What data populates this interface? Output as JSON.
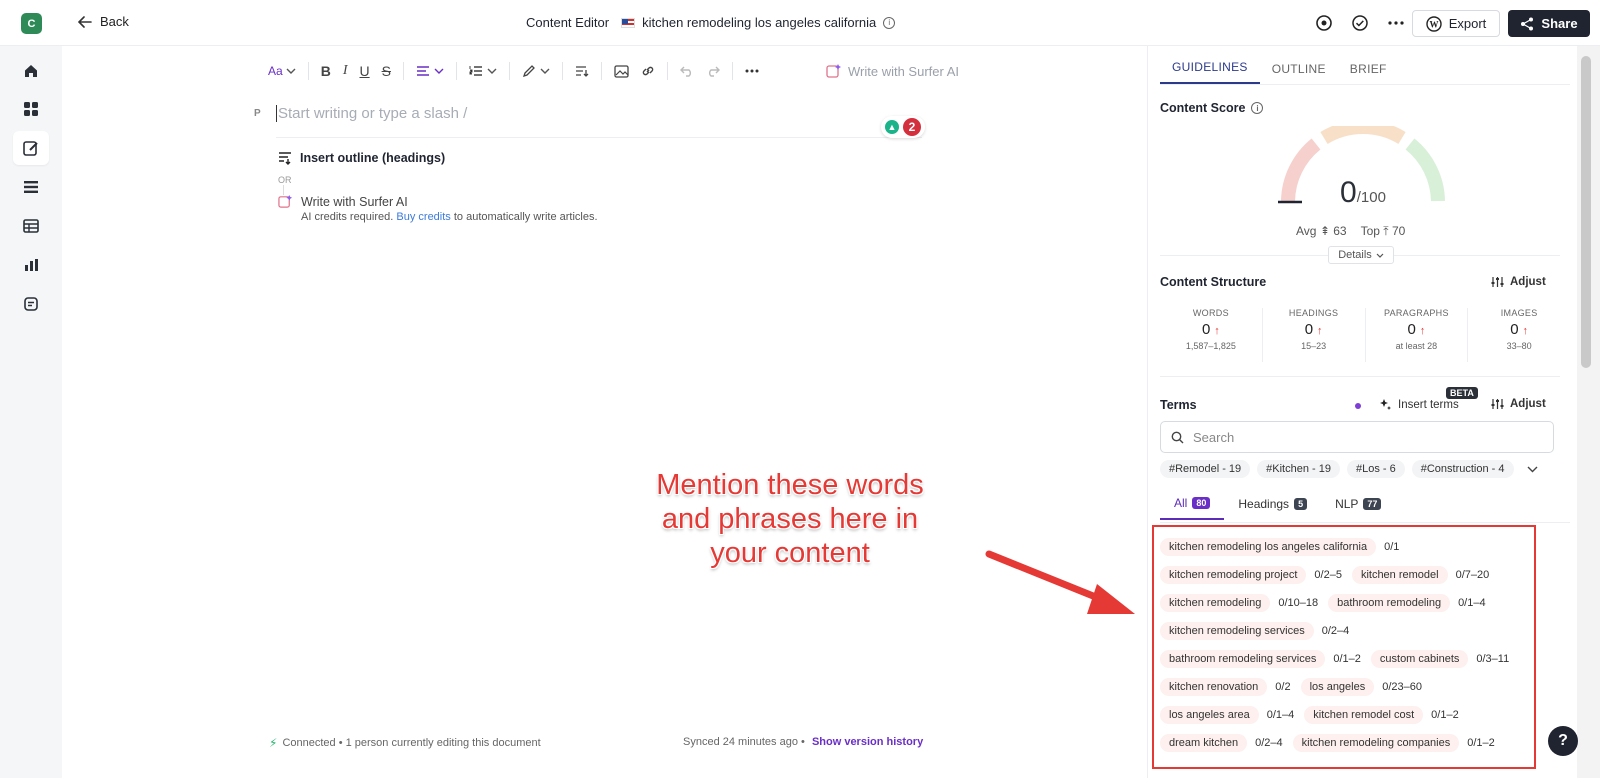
{
  "app": {
    "logo_letter": "C"
  },
  "header": {
    "back_label": "Back",
    "section": "Content Editor",
    "doc_title": "kitchen remodeling los angeles california",
    "export_label": "Export",
    "share_label": "Share"
  },
  "editor": {
    "paragraph_marker": "P",
    "placeholder": "Start writing or type a slash /",
    "grammar_count": "2",
    "write_with_ai_toolbar": "Write with Surfer AI",
    "insert_outline": "Insert outline (headings)",
    "or_label": "OR",
    "write_with_ai": "Write with Surfer AI",
    "credits_pre": "AI credits required.",
    "credits_link": "Buy credits",
    "credits_post": "to automatically write articles.",
    "status_connected": "Connected • 1 person currently editing this document",
    "synced": "Synced 24 minutes ago •",
    "version_history": "Show version history"
  },
  "annotation": {
    "text_line1": "Mention these words",
    "text_line2": "and phrases here in",
    "text_line3": "your content",
    "color": "#e53935"
  },
  "panel": {
    "tabs": [
      "GUIDELINES",
      "OUTLINE",
      "BRIEF"
    ],
    "content_score_title": "Content Score",
    "score": "0",
    "score_max": "/100",
    "avg_label": "Avg",
    "avg_value": "63",
    "top_label": "Top",
    "top_value": "70",
    "details_label": "Details",
    "structure_title": "Content Structure",
    "adjust_label": "Adjust",
    "structure": [
      {
        "label": "WORDS",
        "value": "0",
        "range": "1,587–1,825"
      },
      {
        "label": "HEADINGS",
        "value": "0",
        "range": "15–23"
      },
      {
        "label": "PARAGRAPHS",
        "value": "0",
        "range": "at least 28"
      },
      {
        "label": "IMAGES",
        "value": "0",
        "range": "33–80"
      }
    ],
    "terms_title": "Terms",
    "beta": "BETA",
    "insert_terms": "Insert terms",
    "search_placeholder": "Search",
    "topic_chips": [
      "#Remodel - 19",
      "#Kitchen - 19",
      "#Los - 6",
      "#Construction - 4"
    ],
    "filter_tabs": [
      {
        "label": "All",
        "count": "80"
      },
      {
        "label": "Headings",
        "count": "5"
      },
      {
        "label": "NLP",
        "count": "77"
      }
    ],
    "terms": [
      {
        "name": "kitchen remodeling los angeles california",
        "value": "0/1"
      },
      {
        "name": "kitchen remodeling project",
        "value": "0/2–5"
      },
      {
        "name": "kitchen remodel",
        "value": "0/7–20"
      },
      {
        "name": "kitchen remodeling",
        "value": "0/10–18"
      },
      {
        "name": "bathroom remodeling",
        "value": "0/1–4"
      },
      {
        "name": "kitchen remodeling services",
        "value": "0/2–4"
      },
      {
        "name": "bathroom remodeling services",
        "value": "0/1–2"
      },
      {
        "name": "custom cabinets",
        "value": "0/3–11"
      },
      {
        "name": "kitchen renovation",
        "value": "0/2"
      },
      {
        "name": "los angeles",
        "value": "0/23–60"
      },
      {
        "name": "los angeles area",
        "value": "0/1–4"
      },
      {
        "name": "kitchen remodel cost",
        "value": "0/1–2"
      },
      {
        "name": "dream kitchen",
        "value": "0/2–4"
      },
      {
        "name": "kitchen remodeling companies",
        "value": "0/1–2"
      }
    ],
    "help": "?"
  }
}
